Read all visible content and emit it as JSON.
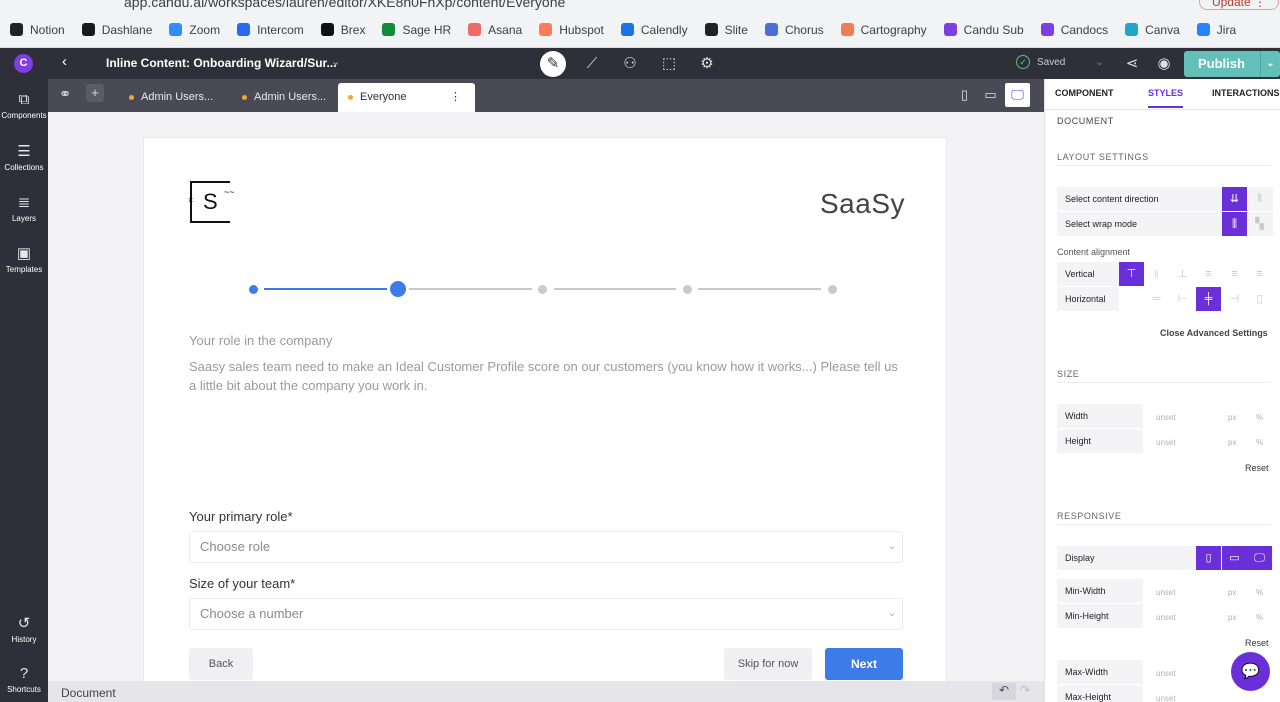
{
  "browser": {
    "url": "app.candu.ai/workspaces/lauren/editor/XKE8h0FhXp/content/Everyone",
    "bookmarks": [
      {
        "label": "Notion",
        "color": "#222222"
      },
      {
        "label": "Dashlane",
        "color": "#1a1a1a"
      },
      {
        "label": "Zoom",
        "color": "#2d8cff"
      },
      {
        "label": "Intercom",
        "color": "#2a6af0"
      },
      {
        "label": "Brex",
        "color": "#111111"
      },
      {
        "label": "Sage HR",
        "color": "#148a3c"
      },
      {
        "label": "Asana",
        "color": "#f06a6a"
      },
      {
        "label": "Hubspot",
        "color": "#ff7a59"
      },
      {
        "label": "Calendly",
        "color": "#1a73e8"
      },
      {
        "label": "Slite",
        "color": "#222222"
      },
      {
        "label": "Chorus",
        "color": "#4b6fd6"
      },
      {
        "label": "Cartography",
        "color": "#f07c56"
      },
      {
        "label": "Candu Sub",
        "color": "#7b3fe4"
      },
      {
        "label": "Candocs",
        "color": "#7b3fe4"
      },
      {
        "label": "Canva",
        "color": "#1fa6c8"
      },
      {
        "label": "Jira",
        "color": "#2684ff"
      }
    ],
    "update_label": "Update"
  },
  "topbar": {
    "title": "Inline Content: Onboarding Wizard/Sur...",
    "saved_label": "Saved",
    "publish_label": "Publish"
  },
  "rail": {
    "components": "Components",
    "collections": "Collections",
    "layers": "Layers",
    "templates": "Templates",
    "history": "History",
    "shortcuts": "Shortcuts"
  },
  "tabs": [
    "Admin Users...",
    "Admin Users...",
    "Everyone"
  ],
  "content": {
    "brand": "SaaSy",
    "question_title": "Your role in the company",
    "question_desc": "Saasy sales team need to make an Ideal Customer Profile score on our customers (you know how it works...) Please tell us a little bit about the company you work in.",
    "role_label": "Your primary role*",
    "role_placeholder": "Choose role",
    "team_label": "Size of your team*",
    "team_placeholder": "Choose a number",
    "back_label": "Back",
    "skip_label": "Skip for now",
    "next_label": "Next",
    "current_step": 2,
    "total_steps": 5
  },
  "statusbar": {
    "label": "Document"
  },
  "panel": {
    "tabs": [
      "COMPONENT",
      "STYLES",
      "INTERACTIONS"
    ],
    "document": "DOCUMENT",
    "layout_settings": "LAYOUT SETTINGS",
    "content_direction": "Select content direction",
    "wrap_mode": "Select wrap mode",
    "content_alignment": "Content alignment",
    "vertical": "Vertical",
    "horizontal": "Horizontal",
    "close_advanced": "Close Advanced Settings",
    "size": "SIZE",
    "width": "Width",
    "height": "Height",
    "unset": "unset",
    "px": "px",
    "pct": "%",
    "reset": "Reset",
    "responsive": "RESPONSIVE",
    "display": "Display",
    "min_width": "Min-Width",
    "min_height": "Min-Height",
    "max_width": "Max-Width",
    "max_height": "Max-Height"
  },
  "colors": {
    "accent": "#6a2fd9",
    "progress": "#3d7be8",
    "next_button": "#3d7be8",
    "publish": "#62c0b8"
  }
}
